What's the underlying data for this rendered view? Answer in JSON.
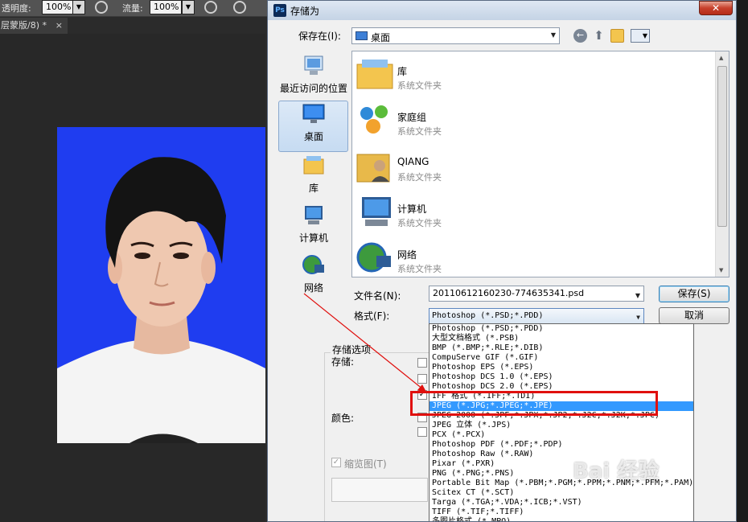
{
  "photoshop": {
    "toolbar": {
      "opacity_label": "透明度:",
      "opacity_value": "100%",
      "flow_label": "流量:",
      "flow_value": "100%"
    },
    "doc_tab": {
      "label": "层蒙版/8) *",
      "close": "×"
    }
  },
  "dialog": {
    "title": "存储为",
    "title_icon": "Ps",
    "close": "✕",
    "save_in_label": "保存在(I):",
    "save_in_value": "桌面",
    "sidebar": [
      {
        "label": "最近访问的位置",
        "icon": "recent-places-icon"
      },
      {
        "label": "桌面",
        "icon": "desktop-icon",
        "selected": true
      },
      {
        "label": "库",
        "icon": "libraries-icon"
      },
      {
        "label": "计算机",
        "icon": "computer-icon"
      },
      {
        "label": "网络",
        "icon": "network-icon"
      }
    ],
    "files": [
      {
        "name": "库",
        "type": "系统文件夹",
        "icon": "libraries-folder-icon"
      },
      {
        "name": "家庭组",
        "type": "系统文件夹",
        "icon": "homegroup-icon"
      },
      {
        "name": "QIANG",
        "type": "系统文件夹",
        "icon": "user-folder-icon"
      },
      {
        "name": "计算机",
        "type": "系统文件夹",
        "icon": "computer-icon"
      },
      {
        "name": "网络",
        "type": "系统文件夹",
        "icon": "network-icon"
      }
    ],
    "filename_label": "文件名(N):",
    "filename_value": "20110612160230-774635341.psd",
    "format_label": "格式(F):",
    "format_value": "Photoshop (*.PSD;*.PDD)",
    "save_button": "保存(S)",
    "cancel_button": "取消",
    "options": {
      "group_label": "存储选项",
      "save_label": "存储:",
      "color_label": "颜色:",
      "thumbnail_label": "缩览图(T)"
    },
    "format_options": [
      "Photoshop (*.PSD;*.PDD)",
      "大型文档格式 (*.PSB)",
      "BMP (*.BMP;*.RLE;*.DIB)",
      "CompuServe GIF (*.GIF)",
      "Photoshop EPS (*.EPS)",
      "Photoshop DCS 1.0 (*.EPS)",
      "Photoshop DCS 2.0 (*.EPS)",
      "IFF 格式 (*.IFF;*.TDI)",
      "JPEG (*.JPG;*.JPEG;*.JPE)",
      "JPEG 2000 (*.JPF;*.JPX;*.JP2;*.J2C;*.J2K;*.JPC)",
      "JPEG 立体 (*.JPS)",
      "PCX (*.PCX)",
      "Photoshop PDF (*.PDF;*.PDP)",
      "Photoshop Raw (*.RAW)",
      "Pixar (*.PXR)",
      "PNG (*.PNG;*.PNS)",
      "Portable Bit Map (*.PBM;*.PGM;*.PPM;*.PNM;*.PFM;*.PAM)",
      "Scitex CT (*.SCT)",
      "Targa (*.TGA;*.VDA;*.ICB;*.VST)",
      "TIFF (*.TIF;*.TIFF)",
      "多图片格式 (*.MPO)"
    ],
    "highlighted_index": 8
  },
  "watermark": {
    "text": "Bai 经验",
    "sub": "jingyan.baidu.com"
  },
  "colors": {
    "photo_bg": "#1f3df0",
    "highlight": "#3399ff",
    "annotation_red": "#e0100e"
  }
}
